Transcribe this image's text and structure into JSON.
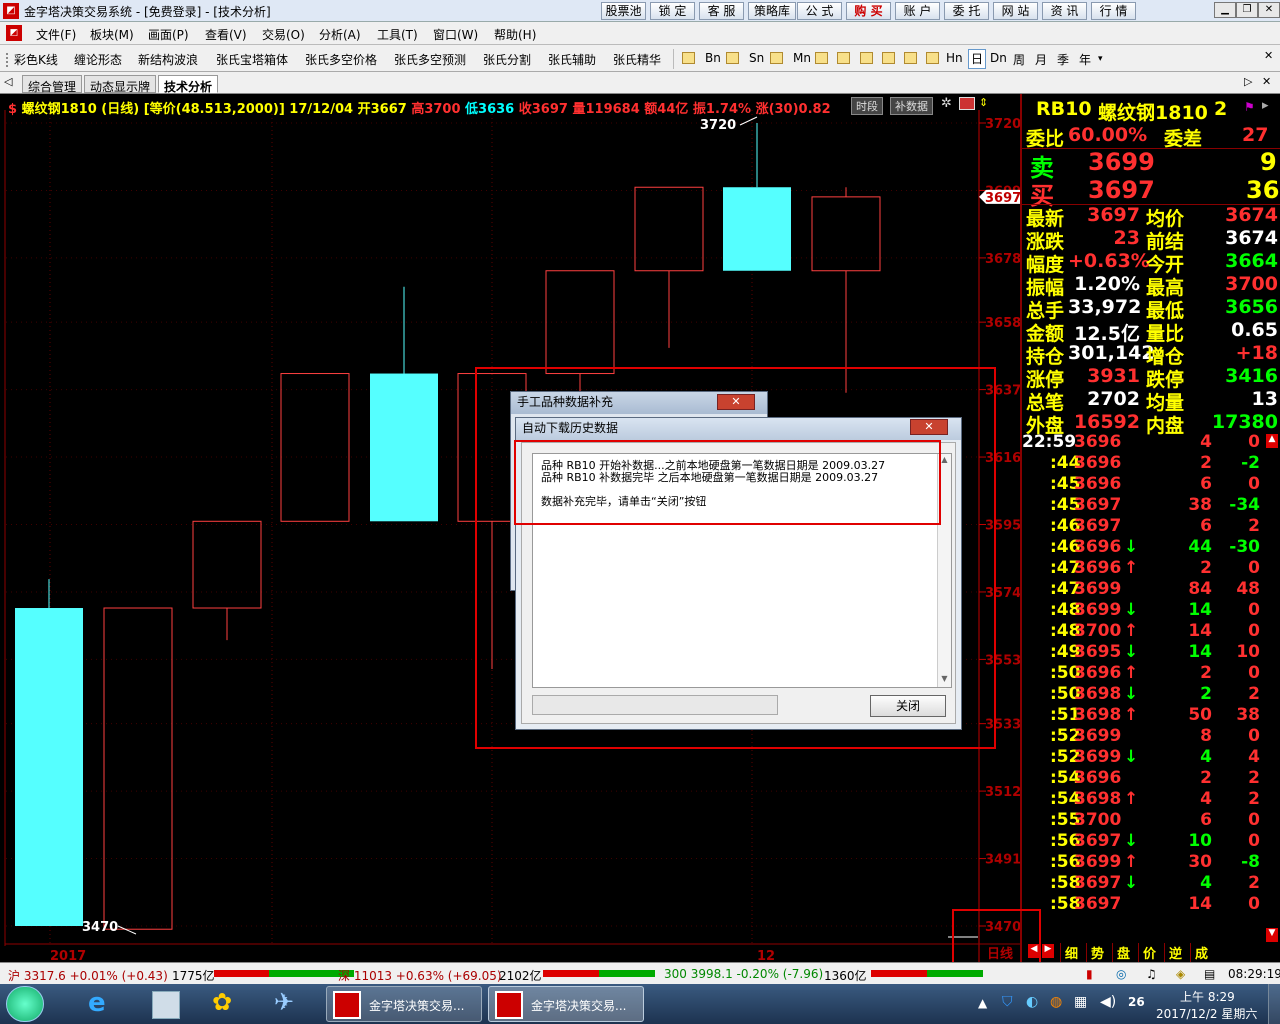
{
  "window": {
    "title": "金字塔决策交易系统 - [免费登录] - [技术分析]"
  },
  "top_buttons": [
    "股票池",
    "锁 定",
    "客 服",
    "策略库",
    "公 式",
    "购 买",
    "账 户",
    "委 托",
    "网 站",
    "资 讯",
    "行 情"
  ],
  "menu": [
    "文件(F)",
    "板块(M)",
    "画面(P)",
    "查看(V)",
    "交易(O)",
    "分析(A)",
    "工具(T)",
    "窗口(W)",
    "帮助(H)"
  ],
  "toolbar": {
    "items": [
      "彩色K线",
      "缠论形态",
      "新结构波浪",
      "张氏宝塔箱体",
      "张氏多空价格",
      "张氏多空预测",
      "张氏分割",
      "张氏辅助",
      "张氏精华"
    ],
    "periods": [
      "Bn",
      "Sn",
      "Mn",
      "Hn",
      "日",
      "Dn",
      "周",
      "月",
      "季",
      "年"
    ]
  },
  "tabs": [
    "综合管理",
    "动态显示牌",
    "技术分析"
  ],
  "info_line": {
    "symbol": "螺纹钢1810 (日线)",
    "price_mode": "[等价(48.513,2000)]",
    "date": "17/12/04",
    "open": "开3667",
    "high": "高3700",
    "low": "低3636",
    "close": "收3697",
    "volume": "量119684",
    "amount": "额44亿",
    "amplitude": "振1.74%",
    "change": "涨(30)0.82",
    "btn_timeshare": "时段",
    "btn_supplement": "补数据"
  },
  "chart_data": {
    "type": "candlestick",
    "yticks": [
      3720,
      3699,
      3678,
      3658,
      3637,
      3616,
      3595,
      3574,
      3553,
      3533,
      3512,
      3491,
      3470
    ],
    "ylim": [
      3466,
      3722
    ],
    "current_price_label": "3697",
    "high_label": "3720",
    "low_label": "3470",
    "x_labels": [
      "2017",
      "12"
    ],
    "period_label": "日线",
    "candles": [
      {
        "open": 3569,
        "close": 3470,
        "high": 3578,
        "low": 3470,
        "color": "cyan"
      },
      {
        "open": 3469,
        "close": 3569,
        "high": 3569,
        "low": 3469,
        "color": "red"
      },
      {
        "open": 3569,
        "close": 3596,
        "high": 3596,
        "low": 3559,
        "color": "red"
      },
      {
        "open": 3596,
        "close": 3642,
        "high": 3642,
        "low": 3596,
        "color": "red"
      },
      {
        "open": 3642,
        "close": 3596,
        "high": 3669,
        "low": 3596,
        "color": "cyan"
      },
      {
        "open": 3596,
        "close": 3642,
        "high": 3642,
        "low": 3550,
        "color": "red"
      },
      {
        "open": 3642,
        "close": 3674,
        "high": 3674,
        "low": 3600,
        "color": "red"
      },
      {
        "open": 3674,
        "close": 3700,
        "high": 3700,
        "low": 3650,
        "color": "red"
      },
      {
        "open": 3700,
        "close": 3674,
        "high": 3720,
        "low": 3674,
        "color": "cyan"
      },
      {
        "open": 3674,
        "close": 3697,
        "high": 3700,
        "low": 3636,
        "color": "red"
      }
    ]
  },
  "dialog_outer": {
    "title": "手工品种数据补充"
  },
  "dialog_inner": {
    "title": "自动下载历史数据",
    "line1": "品种 RB10 开始补数据...之前本地硬盘第一笔数据日期是 2009.03.27",
    "line2": "品种 RB10 补数据完毕 之后本地硬盘第一笔数据日期是 2009.03.27",
    "line3": "数据补充完毕，请单击“关闭”按钮",
    "close_button": "关闭"
  },
  "quote": {
    "code": "RB10",
    "name": "螺纹钢1810",
    "num": "2",
    "weibi_label": "委比",
    "weibi": "60.00%",
    "weicha_label": "委差",
    "weicha": "27",
    "sell_label": "卖",
    "sell_price": "3699",
    "sell_vol": "9",
    "buy_label": "买",
    "buy_price": "3697",
    "buy_vol": "36",
    "rows": [
      [
        "最新",
        "3697",
        "均价",
        "3674"
      ],
      [
        "涨跌",
        "23",
        "前结",
        "3674"
      ],
      [
        "幅度",
        "+0.63%",
        "今开",
        "3664"
      ],
      [
        "振幅",
        "1.20%",
        "最高",
        "3700"
      ],
      [
        "总手",
        "33,972",
        "最低",
        "3656"
      ],
      [
        "金额",
        "12.5亿",
        "量比",
        "0.65"
      ],
      [
        "持仓",
        "301,142",
        "增仓",
        "+18"
      ],
      [
        "涨停",
        "3931",
        "跌停",
        "3416"
      ],
      [
        "总笔",
        "2702",
        "均量",
        "13"
      ],
      [
        "外盘",
        "16592",
        "内盘",
        "17380"
      ]
    ]
  },
  "ticks": [
    [
      "22:59",
      "3696",
      "",
      "4",
      "0"
    ],
    [
      ":44",
      "3696",
      "",
      "2",
      "-2"
    ],
    [
      ":45",
      "3696",
      "",
      "6",
      "0"
    ],
    [
      ":45",
      "3697",
      "",
      "38",
      "-34"
    ],
    [
      ":46",
      "3697",
      "",
      "6",
      "2"
    ],
    [
      ":46",
      "3696",
      "↓",
      "44",
      "-30"
    ],
    [
      ":47",
      "3696",
      "↑",
      "2",
      "0"
    ],
    [
      ":47",
      "3699",
      "",
      "84",
      "48"
    ],
    [
      ":48",
      "3699",
      "↓",
      "14",
      "0"
    ],
    [
      ":48",
      "3700",
      "↑",
      "14",
      "0"
    ],
    [
      ":49",
      "3695",
      "↓",
      "14",
      "10"
    ],
    [
      ":50",
      "3696",
      "↑",
      "2",
      "0"
    ],
    [
      ":50",
      "3698",
      "↓",
      "2",
      "2"
    ],
    [
      ":51",
      "3698",
      "↑",
      "50",
      "38"
    ],
    [
      ":52",
      "3699",
      "",
      "8",
      "0"
    ],
    [
      ":52",
      "3699",
      "↓",
      "4",
      "4"
    ],
    [
      ":54",
      "3696",
      "",
      "2",
      "2"
    ],
    [
      ":54",
      "3698",
      "↑",
      "4",
      "2"
    ],
    [
      ":55",
      "3700",
      "",
      "6",
      "0"
    ],
    [
      ":56",
      "3697",
      "↓",
      "10",
      "0"
    ],
    [
      ":56",
      "3699",
      "↑",
      "30",
      "-8"
    ],
    [
      ":58",
      "3697",
      "↓",
      "4",
      "2"
    ],
    [
      ":58",
      "3697",
      "",
      "14",
      "0"
    ]
  ],
  "right_tabs": [
    "细",
    "势",
    "盘",
    "价",
    "逆",
    "成"
  ],
  "status": {
    "sh": "沪 3317.6 +0.01% (+0.43)",
    "sh_amt": "1775亿",
    "sz": "深 11013 +0.63% (+69.05)",
    "sz_amt": "2102亿",
    "hs300": "300 3998.1 -0.20% (-7.96)",
    "hs_amt": "1360亿",
    "time": "08:29:19"
  },
  "taskbar": {
    "item1": "金字塔决策交易...",
    "item2": "金字塔决策交易...",
    "clock_time": "上午 8:29",
    "clock_date": "2017/12/2 星期六",
    "badge": "26"
  }
}
